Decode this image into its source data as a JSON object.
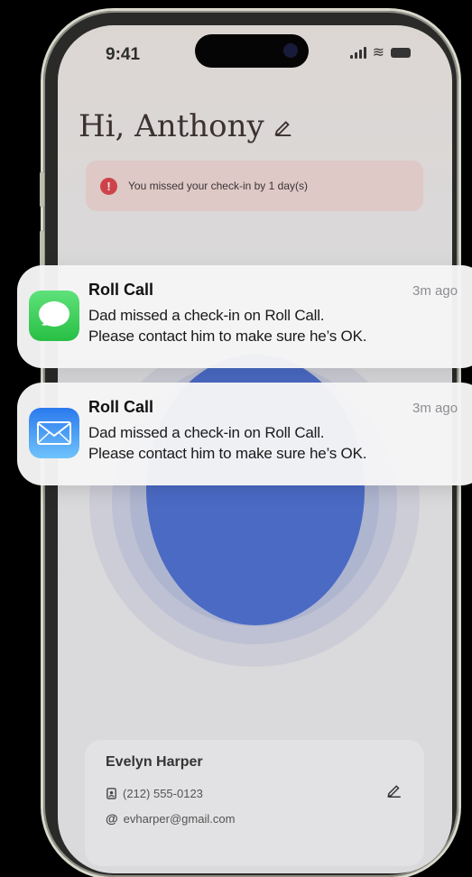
{
  "status_bar": {
    "time": "9:41"
  },
  "home": {
    "greeting": "Hi, Anthony",
    "alert_text": "You missed your check-in by 1 day(s)",
    "alert_symbol": "!"
  },
  "contact_card": {
    "name": "Evelyn Harper",
    "phone": "(212) 555-0123",
    "email": "evharper@gmail.com"
  },
  "notifications": [
    {
      "app_icon": "messages-icon",
      "title": "Roll Call",
      "time": "3m ago",
      "line1": "Dad missed a check-in on Roll Call.",
      "line2": "Please contact him to make sure he’s OK."
    },
    {
      "app_icon": "mail-icon",
      "title": "Roll Call",
      "time": "3m ago",
      "line1": "Dad missed a check-in on Roll Call.",
      "line2": "Please contact him to make sure he’s OK."
    }
  ],
  "colors": {
    "alert_bg": "#ebd5d3",
    "alert_dot": "#d9444a",
    "circle_blue": "#4a6ed0",
    "messages_green": "#33c759",
    "mail_blue": "#3d8ff0"
  }
}
